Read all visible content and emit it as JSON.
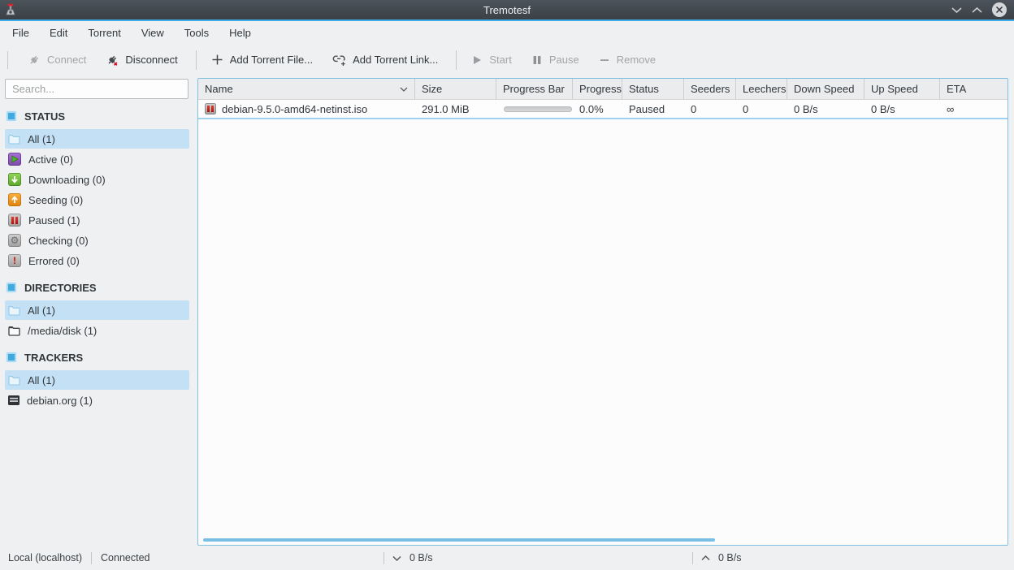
{
  "window": {
    "title": "Tremotesf"
  },
  "menubar": {
    "items": [
      "File",
      "Edit",
      "Torrent",
      "View",
      "Tools",
      "Help"
    ]
  },
  "toolbar": {
    "buttons": [
      {
        "label": "Connect",
        "icon": "plug-connect-icon",
        "enabled": false
      },
      {
        "label": "Disconnect",
        "icon": "plug-disconnect-icon",
        "enabled": true
      },
      {
        "label": "Add Torrent File...",
        "icon": "plus-icon",
        "enabled": true
      },
      {
        "label": "Add Torrent Link...",
        "icon": "link-plus-icon",
        "enabled": true
      },
      {
        "label": "Start",
        "icon": "play-icon",
        "enabled": false
      },
      {
        "label": "Pause",
        "icon": "pause-icon",
        "enabled": false
      },
      {
        "label": "Remove",
        "icon": "minus-icon",
        "enabled": false
      }
    ]
  },
  "sidebar": {
    "search": {
      "placeholder": "Search..."
    },
    "sections": [
      {
        "title": "STATUS",
        "items": [
          {
            "label": "All (1)",
            "icon": "folder-icon",
            "selected": true
          },
          {
            "label": "Active (0)",
            "icon": "active-icon",
            "selected": false
          },
          {
            "label": "Downloading (0)",
            "icon": "downloading-icon",
            "selected": false
          },
          {
            "label": "Seeding (0)",
            "icon": "seeding-icon",
            "selected": false
          },
          {
            "label": "Paused (1)",
            "icon": "paused-icon",
            "selected": false
          },
          {
            "label": "Checking (0)",
            "icon": "checking-icon",
            "selected": false
          },
          {
            "label": "Errored (0)",
            "icon": "errored-icon",
            "selected": false
          }
        ]
      },
      {
        "title": "DIRECTORIES",
        "items": [
          {
            "label": "All (1)",
            "icon": "folder-icon",
            "selected": true
          },
          {
            "label": "/media/disk (1)",
            "icon": "folder-dark-icon",
            "selected": false
          }
        ]
      },
      {
        "title": "TRACKERS",
        "items": [
          {
            "label": "All (1)",
            "icon": "folder-icon",
            "selected": true
          },
          {
            "label": "debian.org (1)",
            "icon": "tracker-icon",
            "selected": false
          }
        ]
      }
    ]
  },
  "table": {
    "columns": [
      "Name",
      "Size",
      "Progress Bar",
      "Progress",
      "Status",
      "Seeders",
      "Leechers",
      "Down Speed",
      "Up Speed",
      "ETA"
    ],
    "sort_indicator_column": "Name",
    "rows": [
      {
        "icon": "paused-icon",
        "name": "debian-9.5.0-amd64-netinst.iso",
        "size": "291.0 MiB",
        "progress_percent": 0,
        "progress": "0.0%",
        "status": "Paused",
        "seeders": "0",
        "leechers": "0",
        "down_speed": "0 B/s",
        "up_speed": "0 B/s",
        "eta": "∞"
      }
    ]
  },
  "statusbar": {
    "server": "Local (localhost)",
    "connection": "Connected",
    "download_speed": "0 B/s",
    "upload_speed": "0 B/s"
  },
  "colors": {
    "accent": "#3daee9",
    "titlebar": "#42484e",
    "selection": "#c4e0f4",
    "table_border": "#7fbfdf",
    "scrollbar_thumb": "#79bfe3",
    "paused_red": "#c4150c"
  }
}
